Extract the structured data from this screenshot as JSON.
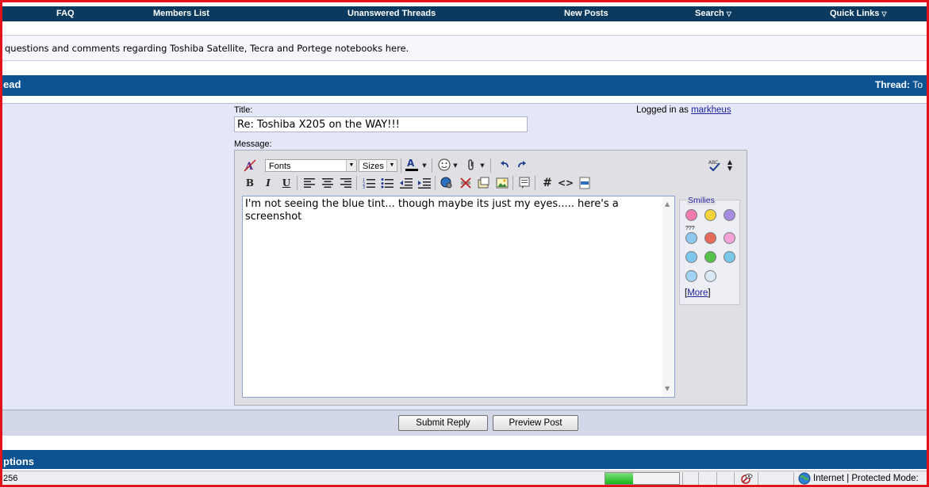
{
  "nav": {
    "items": [
      "FAQ",
      "Members List",
      "Unanswered Threads",
      "New Posts",
      "Search",
      "Quick Links"
    ]
  },
  "forum_description": "questions and comments regarding Toshiba Satellite, Tecra and Portege notebooks here.",
  "reply_header": {
    "left": "ead",
    "right_label": "Thread:",
    "right_value": "To"
  },
  "form": {
    "title_label": "Title:",
    "title_value": "Re: Toshiba X205 on the WAY!!!",
    "message_label": "Message:",
    "logged_in_prefix": "Logged in as",
    "username": "markheus"
  },
  "toolbar": {
    "fonts": "Fonts",
    "sizes": "Sizes",
    "bold": "B",
    "italic": "I",
    "underline": "U",
    "hash": "#",
    "code": "<>"
  },
  "message_text": "I'm not seeing the blue tint... though maybe its just my eyes..... here's a screenshot",
  "smilies": {
    "title": "Smilies",
    "more_open": "[",
    "more_label": "More",
    "more_close": "]",
    "question_text": "???"
  },
  "buttons": {
    "submit": "Submit Reply",
    "preview": "Preview Post"
  },
  "options_header": "ptions",
  "statusbar": {
    "left": "256",
    "zone": "Internet | Protected Mode:",
    "progress": 0.38
  }
}
